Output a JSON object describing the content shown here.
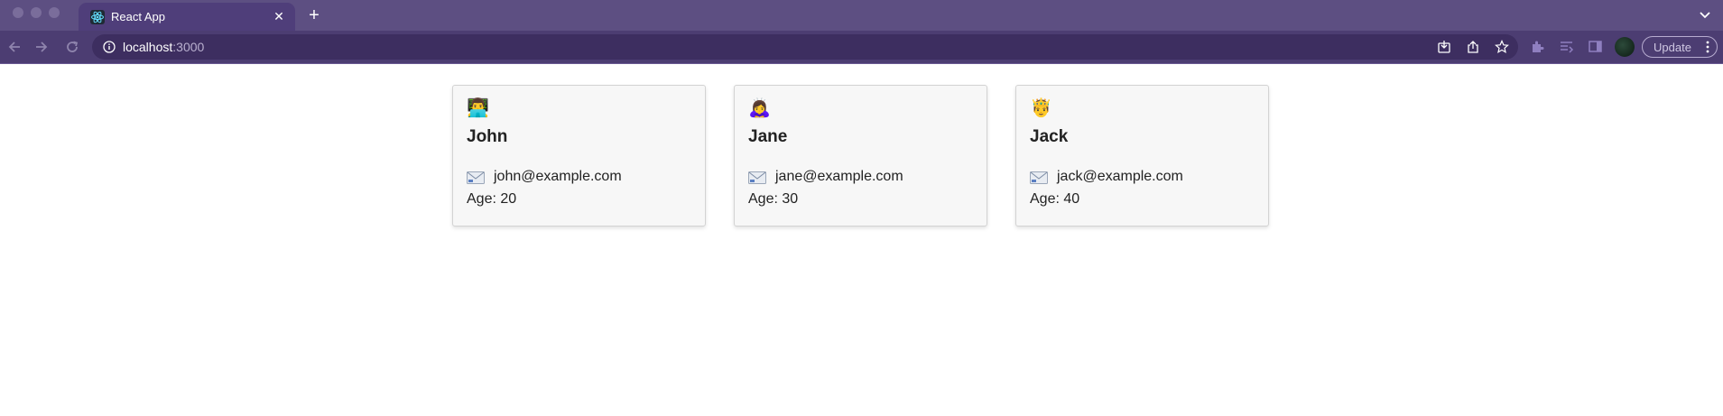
{
  "browser": {
    "tab_title": "React App",
    "url_host": "localhost",
    "url_port": ":3000",
    "update_label": "Update",
    "icons": [
      "back-arrow-icon",
      "forward-arrow-icon",
      "reload-icon",
      "info-icon",
      "install-icon",
      "share-icon",
      "bookmark-star-icon",
      "extensions-icon",
      "reading-list-icon",
      "side-panel-icon",
      "profile-avatar",
      "kebab-menu-icon"
    ]
  },
  "users": [
    {
      "emoji": "👨‍💻",
      "name": "John",
      "email_icon": "📧",
      "email": "john@example.com",
      "age": "Age: 20"
    },
    {
      "emoji": "🙇‍♀️",
      "name": "Jane",
      "email_icon": "📧",
      "email": "jane@example.com",
      "age": "Age: 30"
    },
    {
      "emoji": "🤴",
      "name": "Jack",
      "email_icon": "📧",
      "email": "jack@example.com",
      "age": "Age: 40"
    }
  ],
  "colors": {
    "chrome_tabstrip": "#5d4f82",
    "chrome_toolbar": "#4c3d72",
    "card_background": "#f7f7f7",
    "card_border": "#d3d3d3",
    "text": "#222222"
  }
}
